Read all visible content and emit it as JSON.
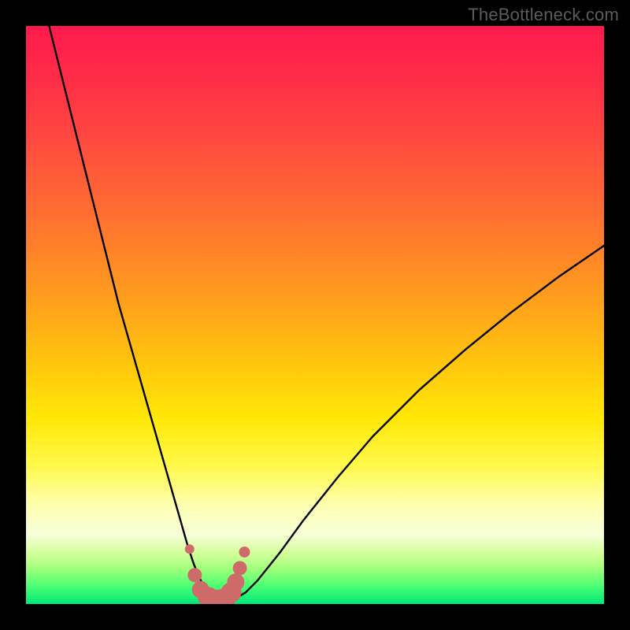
{
  "watermark": "TheBottleneck.com",
  "colors": {
    "frame": "#000000",
    "curve_stroke": "#000000",
    "marker_stroke": "#cf6a6a",
    "marker_fill": "#cf6a6a"
  },
  "chart_data": {
    "type": "line",
    "title": "",
    "xlabel": "",
    "ylabel": "",
    "xlim": [
      0,
      100
    ],
    "ylim": [
      0,
      100
    ],
    "grid": false,
    "legend": false,
    "series": [
      {
        "name": "bottleneck-curve",
        "x": [
          4,
          6,
          8,
          10,
          12,
          14,
          16,
          18,
          20,
          22,
          24,
          26,
          27,
          28,
          29,
          30,
          31,
          32,
          33,
          34,
          35,
          36,
          38,
          40,
          44,
          48,
          54,
          60,
          68,
          76,
          84,
          92,
          100
        ],
        "y": [
          100,
          92,
          84,
          76,
          68,
          60,
          52,
          45,
          38,
          31,
          24,
          17,
          13.5,
          10,
          7,
          4.5,
          2.8,
          1.6,
          0.8,
          0.4,
          0.4,
          0.8,
          2.0,
          4.0,
          9.0,
          14.5,
          22.0,
          29.0,
          37.0,
          44.0,
          50.5,
          56.5,
          62.0
        ]
      }
    ],
    "markers": {
      "name": "highlight-points",
      "x": [
        28.3,
        29.2,
        30.2,
        31.5,
        33.0,
        34.3,
        35.5,
        36.3,
        37.0,
        37.8
      ],
      "y": [
        9.5,
        5.0,
        2.5,
        1.2,
        0.6,
        0.8,
        2.0,
        3.8,
        6.2,
        9.0
      ],
      "size": [
        6,
        9,
        11,
        13,
        14,
        14,
        13,
        11,
        9,
        7
      ]
    }
  }
}
